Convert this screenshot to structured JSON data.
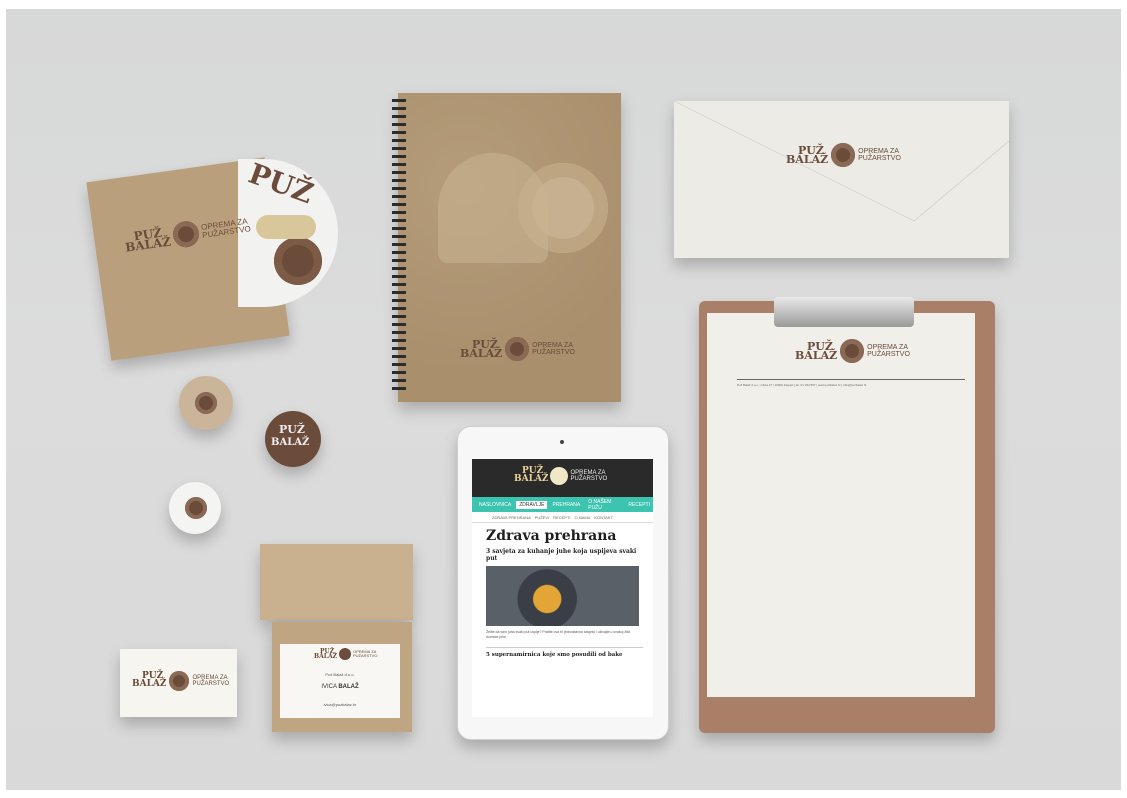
{
  "brand": {
    "line1": "PUŽ",
    "line2": "BALAŽ",
    "tagline_top": "OPREMA ZA",
    "tagline_bottom": "PUŽARSTVO",
    "colors": {
      "brown": "#6b4b3a",
      "cream": "#e8d29a",
      "kraft": "#b89a76",
      "teal": "#3dc4b0"
    }
  },
  "cd_label_letters": "PUŽ",
  "tablet": {
    "nav_items": [
      "NASLOVNICA",
      "ZDRAVLJE",
      "PREHRANA",
      "O NAŠEM PUŽU",
      "RECEPTI"
    ],
    "sub_items": [
      "ZDRAVA PREHRANA",
      "PUŽEVI",
      "RECEPTI",
      "O NAMA",
      "KONTAKT"
    ],
    "page_title": "Zdrava prehrana",
    "article1_title": "3 savjeta za kuhanje juhe koja uspijeva svaki put",
    "article1_text": "Želite da vam juha svaki put uspije? Pratite ova tri jednostavna savjeta i uživajte u svakoj žlici domaće juhe.",
    "article2_title": "5 supernamirnica koje smo posudili od bake"
  },
  "letterhead_info": "Puž Balaž d.o.o. | Ulica 27 | 10000 Zagreb | tel. 01 234 567 | www.puzbalaz.hr | info@puzbalaz.hr",
  "business_card": {
    "company": "Puž Balaž d.o.o.",
    "name_first": "IVICA",
    "name_last": "BALAŽ",
    "contact": "ivica@puzbalaz.hr"
  }
}
